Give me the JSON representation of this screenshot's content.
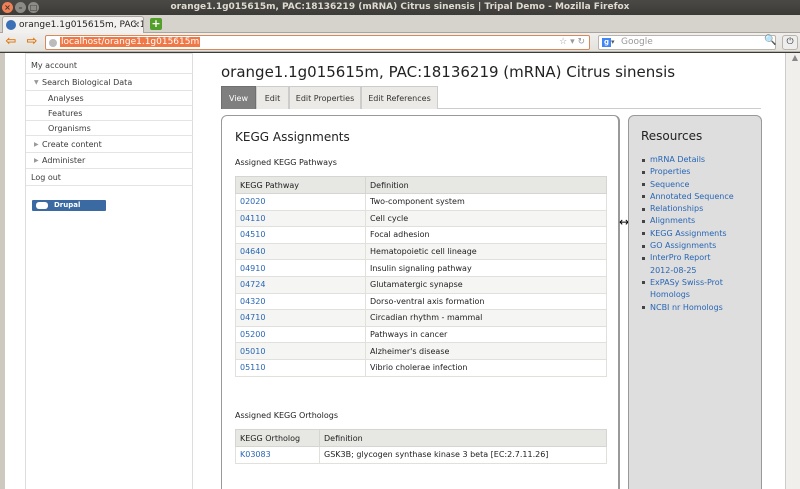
{
  "window": {
    "title": "orange1.1g015615m, PAC:18136219 (mRNA) Citrus sinensis | Tripal Demo - Mozilla Firefox"
  },
  "browser": {
    "tab_label": "orange1.1g015615m, PAC:181...",
    "url": "localhost/orange1.1g015615m",
    "search_placeholder": "Google"
  },
  "sidebar": {
    "items": [
      {
        "label": "My account"
      },
      {
        "label": "Search Biological Data"
      },
      {
        "label": "Analyses"
      },
      {
        "label": "Features"
      },
      {
        "label": "Organisms"
      },
      {
        "label": "Create content"
      },
      {
        "label": "Administer"
      },
      {
        "label": "Log out"
      }
    ],
    "badge": "Drupal"
  },
  "page": {
    "title": "orange1.1g015615m, PAC:18136219 (mRNA) Citrus sinensis",
    "tabs": [
      "View",
      "Edit",
      "Edit Properties",
      "Edit References"
    ]
  },
  "kegg": {
    "heading": "KEGG Assignments",
    "pathways_heading": "Assigned KEGG Pathways",
    "pathway_columns": [
      "KEGG Pathway",
      "Definition"
    ],
    "pathways": [
      [
        "02020",
        "Two-component system"
      ],
      [
        "04110",
        "Cell cycle"
      ],
      [
        "04510",
        "Focal adhesion"
      ],
      [
        "04640",
        "Hematopoietic cell lineage"
      ],
      [
        "04910",
        "Insulin signaling pathway"
      ],
      [
        "04724",
        "Glutamatergic synapse"
      ],
      [
        "04320",
        "Dorso-ventral axis formation"
      ],
      [
        "04710",
        "Circadian rhythm - mammal"
      ],
      [
        "05200",
        "Pathways in cancer"
      ],
      [
        "05010",
        "Alzheimer's disease"
      ],
      [
        "05110",
        "Vibrio cholerae infection"
      ]
    ],
    "orthologs_heading": "Assigned KEGG Orthologs",
    "ortholog_columns": [
      "KEGG Ortholog",
      "Definition"
    ],
    "orthologs": [
      [
        "K03083",
        "GSK3B; glycogen synthase kinase 3 beta [EC:2.7.11.26]"
      ]
    ]
  },
  "resources": {
    "heading": "Resources",
    "items": [
      "mRNA Details",
      "Properties",
      "Sequence",
      "Annotated Sequence",
      "Relationships",
      "Alignments",
      "KEGG Assignments",
      "GO Assignments",
      "InterPro Report",
      "2012-08-25",
      "ExPASy Swiss-Prot",
      "Homologs",
      "NCBI nr Homologs"
    ]
  }
}
